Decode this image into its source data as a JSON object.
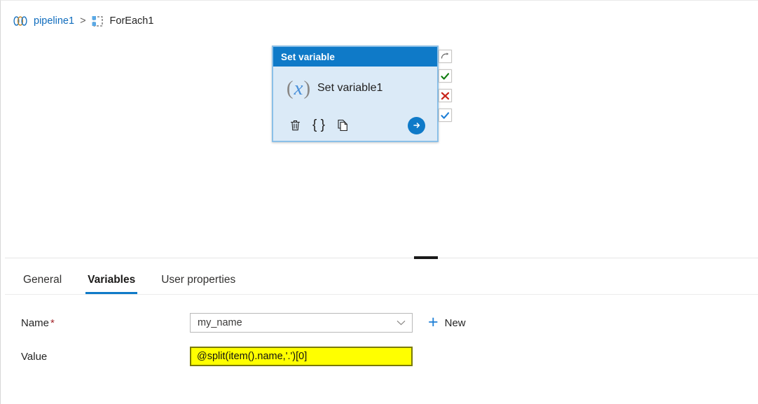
{
  "breadcrumb": {
    "pipeline_icon": "pipeline-icon",
    "root_label": "pipeline1",
    "separator": ">",
    "foreach_icon": "foreach-icon",
    "current_label": "ForEach1"
  },
  "canvas": {
    "activity": {
      "header_label": "Set variable",
      "type_icon": "fx-icon",
      "fx_open_paren": "(",
      "fx_x": "x",
      "fx_close_paren": ")",
      "name": "Set variable1",
      "actions": [
        {
          "name": "delete-activity-button",
          "icon": "trash-icon",
          "label": ""
        },
        {
          "name": "code-activity-button",
          "icon": "code-braces-icon",
          "label": "{ }"
        },
        {
          "name": "clone-activity-button",
          "icon": "copy-icon",
          "label": ""
        }
      ],
      "run_button": {
        "name": "run-activity-button",
        "icon": "arrow-right-circle-icon"
      },
      "handles": [
        {
          "name": "on-completion-handle",
          "icon": "curved-arrow-icon",
          "kind": "comp"
        },
        {
          "name": "on-success-handle",
          "icon": "check-icon",
          "kind": "succ"
        },
        {
          "name": "on-failure-handle",
          "icon": "cross-icon",
          "kind": "fail"
        },
        {
          "name": "on-skip-handle",
          "icon": "check-icon",
          "kind": "skip"
        }
      ]
    }
  },
  "tabs": [
    {
      "label": "General",
      "active": false
    },
    {
      "label": "Variables",
      "active": true
    },
    {
      "label": "User properties",
      "active": false
    }
  ],
  "form": {
    "name_field": {
      "label": "Name",
      "required_marker": "*",
      "value": "my_name",
      "chevron_icon": "chevron-down-icon"
    },
    "new_button": {
      "plus_icon": "plus-icon",
      "label": "New"
    },
    "value_field": {
      "label": "Value",
      "value": "@split(item().name,'.')[0]"
    }
  },
  "colors": {
    "accent": "#0f7ac8",
    "link": "#0f6cbd",
    "success": "#107c10",
    "failure": "#c9241a",
    "skip": "#1e7fd6",
    "required": "#a4262c",
    "highlight_bg": "#ffff00",
    "highlight_border": "#7a7a00",
    "card_body": "#dbeaf7"
  }
}
